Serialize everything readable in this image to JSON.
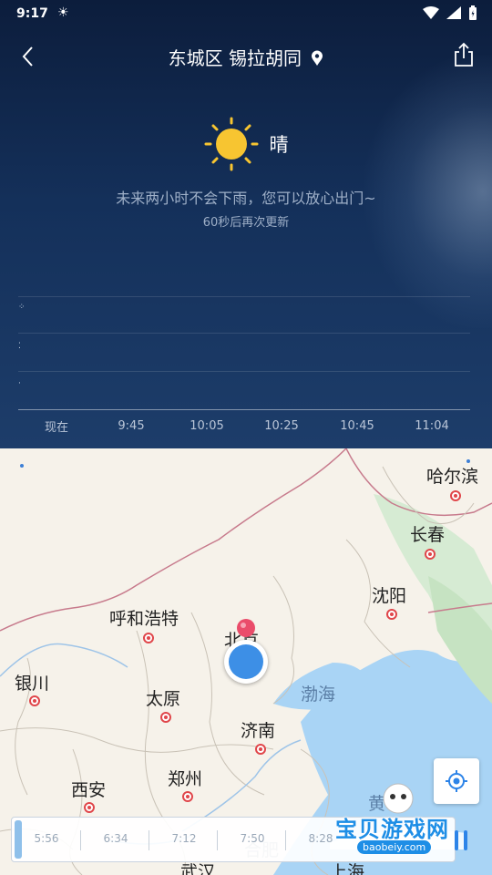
{
  "status_bar": {
    "time": "9:17",
    "sun_glyph": "☀"
  },
  "header": {
    "location_title": "东城区 锡拉胡同"
  },
  "weather": {
    "condition": "晴",
    "forecast_message": "未来两小时不会下雨，您可以放心出门~",
    "update_message": "60秒后再次更新"
  },
  "chart": {
    "x_labels": [
      "现在",
      "9:45",
      "10:05",
      "10:25",
      "10:45",
      "11:04"
    ],
    "level_glyphs": [
      "⁘",
      "⁚",
      "·"
    ]
  },
  "map": {
    "cities": [
      "哈尔滨",
      "长春",
      "沈阳",
      "呼和浩特",
      "北京",
      "银川",
      "太原",
      "济南",
      "西安",
      "郑州",
      "武汉",
      "上海",
      "合肥"
    ],
    "seas": [
      "渤海",
      "黄"
    ]
  },
  "timeline": {
    "labels": [
      "5:56",
      "6:34",
      "7:12",
      "7:50",
      "8:28"
    ]
  },
  "watermark": {
    "brand": "宝贝游戏网",
    "url": "baobeiy.com"
  },
  "colors": {
    "accent": "#2d84e8",
    "city_dot": "#e0464a",
    "sky_top": "#0c1d3c"
  }
}
